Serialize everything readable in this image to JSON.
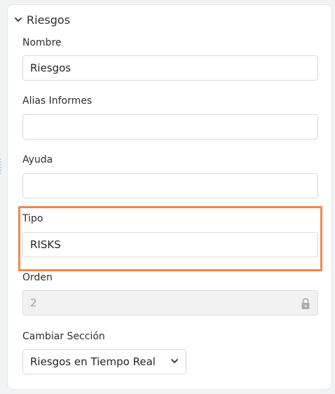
{
  "section": {
    "title": "Riesgos"
  },
  "fields": {
    "nombre": {
      "label": "Nombre",
      "value": "Riesgos"
    },
    "alias": {
      "label": "Alias Informes",
      "value": ""
    },
    "ayuda": {
      "label": "Ayuda",
      "value": ""
    },
    "tipo": {
      "label": "Tipo",
      "value": "RISKS"
    },
    "orden": {
      "label": "Orden",
      "value": "2"
    },
    "cambiar_seccion": {
      "label": "Cambiar Sección",
      "selected": "Riesgos en Tiempo Real"
    }
  },
  "colors": {
    "highlight": "#f0884a",
    "disabled_bg": "#f1f1f1"
  },
  "icons": {
    "collapse": "chevron-down-icon",
    "lock": "lock-icon",
    "select": "chevron-down-icon"
  }
}
